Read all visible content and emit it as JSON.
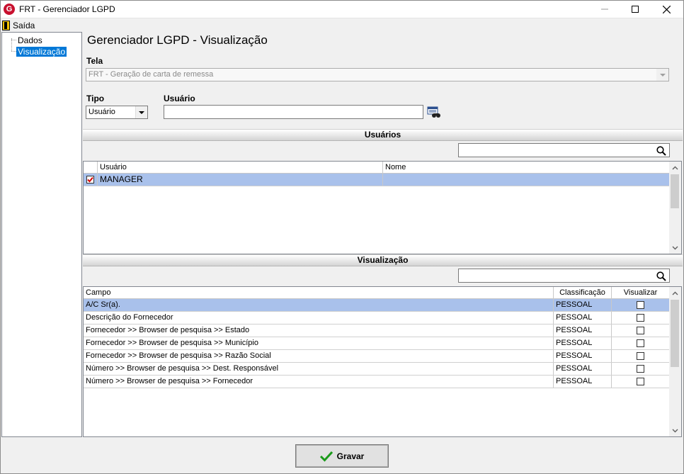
{
  "window": {
    "title": "FRT - Gerenciador LGPD",
    "app_icon_letter": "G"
  },
  "menu": {
    "saida": "Saída"
  },
  "tree": {
    "items": [
      {
        "label": "Dados",
        "selected": false
      },
      {
        "label": "Visualização",
        "selected": true
      }
    ]
  },
  "page": {
    "title": "Gerenciador LGPD - Visualização"
  },
  "form": {
    "tela_label": "Tela",
    "tela_value": "FRT - Geração de carta de remessa",
    "tipo_label": "Tipo",
    "tipo_value": "Usuário",
    "usuario_label": "Usuário",
    "usuario_value": ""
  },
  "usuarios_section": {
    "header": "Usuários",
    "search_value": "",
    "columns": [
      "Usuário",
      "Nome"
    ],
    "rows": [
      {
        "checked": true,
        "usuario": "MANAGER",
        "nome": ""
      }
    ]
  },
  "visualizacao_section": {
    "header": "Visualização",
    "search_value": "",
    "columns": [
      "Campo",
      "Classificação",
      "Visualizar"
    ],
    "rows": [
      {
        "campo": "A/C Sr(a).",
        "classificacao": "PESSOAL",
        "visualizar": false
      },
      {
        "campo": "Descrição do Fornecedor",
        "classificacao": "PESSOAL",
        "visualizar": false
      },
      {
        "campo": "Fornecedor >> Browser de pesquisa >> Estado",
        "classificacao": "PESSOAL",
        "visualizar": false
      },
      {
        "campo": "Fornecedor >> Browser de pesquisa >> Município",
        "classificacao": "PESSOAL",
        "visualizar": false
      },
      {
        "campo": "Fornecedor >> Browser de pesquisa >> Razão Social",
        "classificacao": "PESSOAL",
        "visualizar": false
      },
      {
        "campo": "Número >> Browser de pesquisa >> Dest. Responsável",
        "classificacao": "PESSOAL",
        "visualizar": false
      },
      {
        "campo": "Número >> Browser de pesquisa >> Fornecedor",
        "classificacao": "PESSOAL",
        "visualizar": false
      }
    ]
  },
  "footer": {
    "gravar_label": "Gravar"
  },
  "colors": {
    "selection_row": "#a9c1eb",
    "tree_selection": "#0078d7",
    "gravar_check": "#1a9a1a",
    "checkbox_red": "#d40000"
  }
}
